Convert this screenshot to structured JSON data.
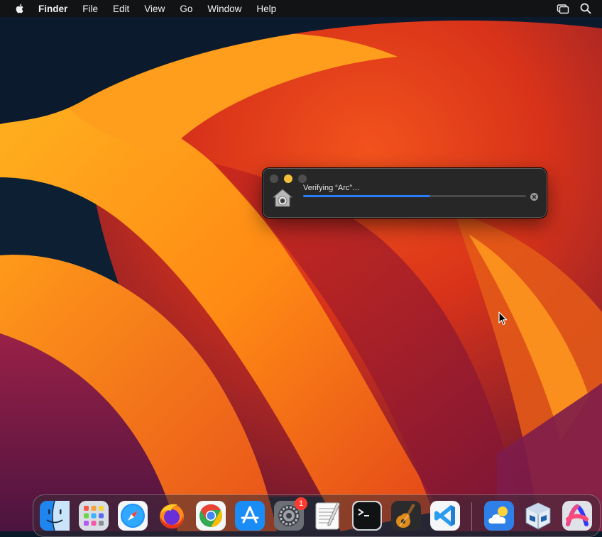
{
  "menubar": {
    "apple_icon": "apple-logo-icon",
    "app_name": "Finder",
    "menus": [
      "File",
      "Edit",
      "View",
      "Go",
      "Window",
      "Help"
    ],
    "status_icons": [
      "screen-mirroring-icon",
      "spotlight-search-icon"
    ]
  },
  "verify_window": {
    "message": "Verifying “Arc”…",
    "progress": 0.57,
    "progress_color": "#2a7cf6",
    "icon": "installer-home-icon",
    "cancel_icon": "cancel-circle-icon"
  },
  "dock": {
    "apps": [
      {
        "name": "Finder",
        "icon": "finder-icon"
      },
      {
        "name": "Launchpad",
        "icon": "launchpad-icon"
      },
      {
        "name": "Safari",
        "icon": "safari-icon"
      },
      {
        "name": "Firefox",
        "icon": "firefox-icon"
      },
      {
        "name": "Google Chrome",
        "icon": "chrome-icon"
      },
      {
        "name": "App Store",
        "icon": "app-store-icon"
      },
      {
        "name": "System Settings",
        "icon": "system-settings-icon",
        "badge": "1"
      },
      {
        "name": "TextEdit",
        "icon": "textedit-icon"
      },
      {
        "name": "Terminal",
        "icon": "terminal-icon"
      },
      {
        "name": "GarageBand",
        "icon": "garageband-icon"
      },
      {
        "name": "Visual Studio Code",
        "icon": "vscode-icon"
      },
      {
        "name": "Weather",
        "icon": "weather-icon"
      },
      {
        "name": "VirtualBox",
        "icon": "virtualbox-icon"
      },
      {
        "name": "Arc",
        "icon": "arc-icon"
      }
    ]
  }
}
